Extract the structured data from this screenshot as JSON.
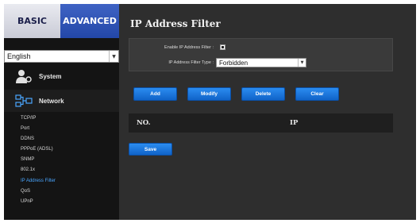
{
  "tabs": {
    "basic": "BASIC",
    "advanced": "ADVANCED"
  },
  "language": {
    "selected": "English"
  },
  "sidebar": {
    "system_label": "System",
    "network_label": "Network",
    "subitems": [
      "TCP/IP",
      "Port",
      "DDNS",
      "PPPoE (ADSL)",
      "SNMP",
      "802.1x",
      "IP Address Filter",
      "QoS",
      "UPnP"
    ],
    "active_subitem": "IP Address Filter"
  },
  "main": {
    "title": "IP Address Filter",
    "enable_label": "Enable IP Address Filter :",
    "enable_checked": true,
    "filter_type_label": "IP Address Filter Type :",
    "filter_type_value": "Forbidden",
    "buttons": {
      "add": "Add",
      "modify": "Modify",
      "delete": "Delete",
      "clear": "Clear",
      "save": "Save"
    },
    "table": {
      "col_no": "NO.",
      "col_ip": "IP"
    }
  },
  "colors": {
    "accent_blue": "#1e7be0",
    "active_link": "#4aa6ff",
    "tab_advanced": "#2f55b8"
  }
}
